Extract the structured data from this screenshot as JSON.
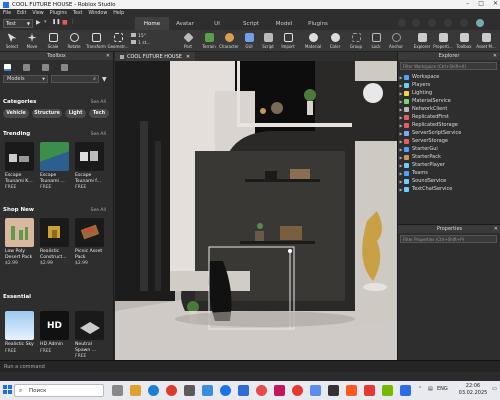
{
  "window": {
    "title": "COOL FUTURE HOUSE - Roblox Studio",
    "controls": [
      "–",
      "□",
      "✕"
    ]
  },
  "menu": [
    "File",
    "Edit",
    "View",
    "Plugins",
    "Test",
    "Window",
    "Help"
  ],
  "tabs": {
    "place_select": "Test",
    "items": [
      "Home",
      "Avatar",
      "UI",
      "Script",
      "Model",
      "Plugins"
    ],
    "active": "Home"
  },
  "ribbon": {
    "tools": [
      "Select",
      "Move",
      "Scale",
      "Rotate",
      "Transform",
      "Geometr..."
    ],
    "snap_values": [
      "15°",
      "1 st..."
    ],
    "insert": [
      "Part",
      "Terrain",
      "Character",
      "GUI",
      "Script",
      "Import",
      "Material",
      "Color",
      "Group",
      "Lock",
      "Anchor"
    ],
    "panels": [
      "Explorer",
      "Properti...",
      "Toolbox",
      "Asset M..."
    ]
  },
  "toolbox": {
    "title": "Toolbox",
    "category_select": "Models",
    "categories_title": "Categories",
    "see_all": "See All",
    "categories": [
      "Vehicle",
      "Structure",
      "Light",
      "Tech"
    ],
    "trending_title": "Trending",
    "trending": [
      {
        "name": "Escape Tsunami K...",
        "price": "FREE"
      },
      {
        "name": "Escape Tsunami ...",
        "price": "FREE"
      },
      {
        "name": "Escape Tsunami f...",
        "price": "FREE"
      }
    ],
    "shop_new_title": "Shop New",
    "shop_new": [
      {
        "name": "Low Poly Desert Pack",
        "price": "$2.99"
      },
      {
        "name": "Realistic Construct...",
        "price": "$2.99"
      },
      {
        "name": "Picnic Asset Pack",
        "price": "$2.99"
      }
    ],
    "essential_title": "Essential",
    "essential": [
      {
        "name": "Realistic Sky",
        "price": "FREE"
      },
      {
        "name": "HD Admin",
        "price": "FREE",
        "badge": "HD"
      },
      {
        "name": "Neutral Spawn ...",
        "price": "FREE"
      }
    ]
  },
  "viewport": {
    "tab": "COOL FUTURE HOUSE"
  },
  "explorer": {
    "title": "Explorer",
    "filter_placeholder": "Filter Workspace (Ctrl+Shift+X)",
    "items": [
      {
        "label": "Workspace",
        "color": "#4da3ff"
      },
      {
        "label": "Players",
        "color": "#6ad0ff"
      },
      {
        "label": "Lighting",
        "color": "#f2d24b"
      },
      {
        "label": "MaterialService",
        "color": "#7bd67b"
      },
      {
        "label": "NetworkClient",
        "color": "#bbbbbb"
      },
      {
        "label": "ReplicatedFirst",
        "color": "#e65e5e"
      },
      {
        "label": "ReplicatedStorage",
        "color": "#e65e5e"
      },
      {
        "label": "ServerScriptService",
        "color": "#7fa7ff"
      },
      {
        "label": "ServerStorage",
        "color": "#e65e5e"
      },
      {
        "label": "StarterGui",
        "color": "#4da3ff"
      },
      {
        "label": "StarterPack",
        "color": "#c79a5b"
      },
      {
        "label": "StarterPlayer",
        "color": "#6ad0ff"
      },
      {
        "label": "Teams",
        "color": "#4da3ff"
      },
      {
        "label": "SoundService",
        "color": "#6ad0ff"
      },
      {
        "label": "TextChatService",
        "color": "#6ad0ff"
      }
    ]
  },
  "properties": {
    "title": "Properties",
    "filter_placeholder": "Filter Properties (Ctrl+Shift+P)"
  },
  "command_bar": {
    "placeholder": "Run a command"
  },
  "taskbar": {
    "search_label": "Поиск",
    "language": "ENG",
    "time": "22:06",
    "date": "03.02.2025"
  }
}
